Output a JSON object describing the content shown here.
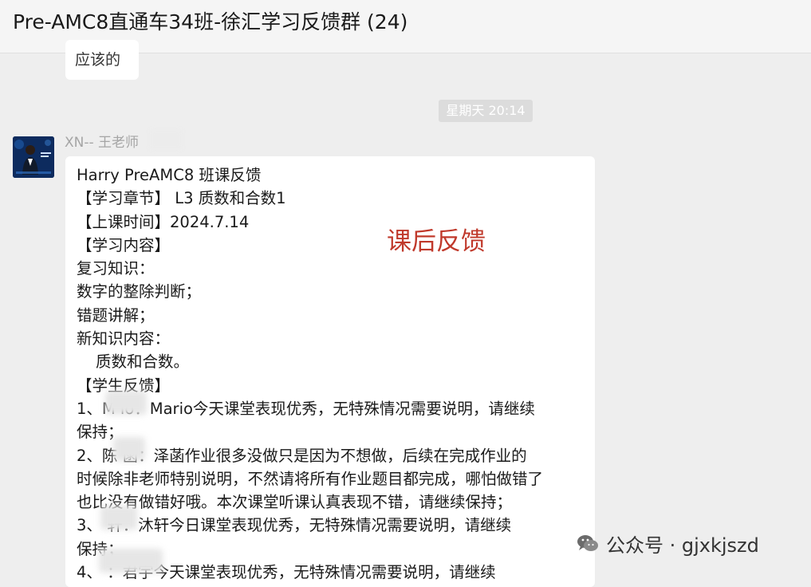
{
  "header": {
    "title": "Pre-AMC8直通车34班-徐汇学习反馈群 (24)"
  },
  "previous_message": {
    "text": "应该的"
  },
  "timestamp": "星期天 20:14",
  "sender": {
    "name": "XN-- 王老师"
  },
  "message": {
    "lines": [
      "Harry PreAMC8 班课反馈",
      "【学习章节】 L3 质数和合数1",
      "【上课时间】2024.7.14",
      "【学习内容】",
      "复习知识：",
      "数字的整除判断；",
      "错题讲解；",
      "新知识内容：",
      "质数和合数。",
      "【学生反馈】",
      "1、M    io：Mario今天课堂表现优秀，无特殊情况需要说明，请继续",
      "保持；",
      "2、陈    菡：泽菡作业很多没做只是因为不想做，后续在完成作业的",
      "时候除非老师特别说明，不然请将所有作业题目都完成，哪怕做错了",
      "也比没有做错好哦。本次课堂听课认真表现不错，请继续保持；",
      "3、     轩：沐轩今日课堂表现优秀，无特殊情况需要说明，请继续",
      "保持；",
      "4、        ：君宇今天课堂表现优秀，无特殊情况需要说明，请继续"
    ],
    "stamp": "课后反馈"
  },
  "watermark": {
    "text": "公众号 · gjxkjszd",
    "icon": "wechat-icon"
  },
  "colors": {
    "stamp": "#c0392b",
    "bubble": "#ffffff",
    "background": "#eeeeee",
    "sender": "#a5a5a5"
  }
}
